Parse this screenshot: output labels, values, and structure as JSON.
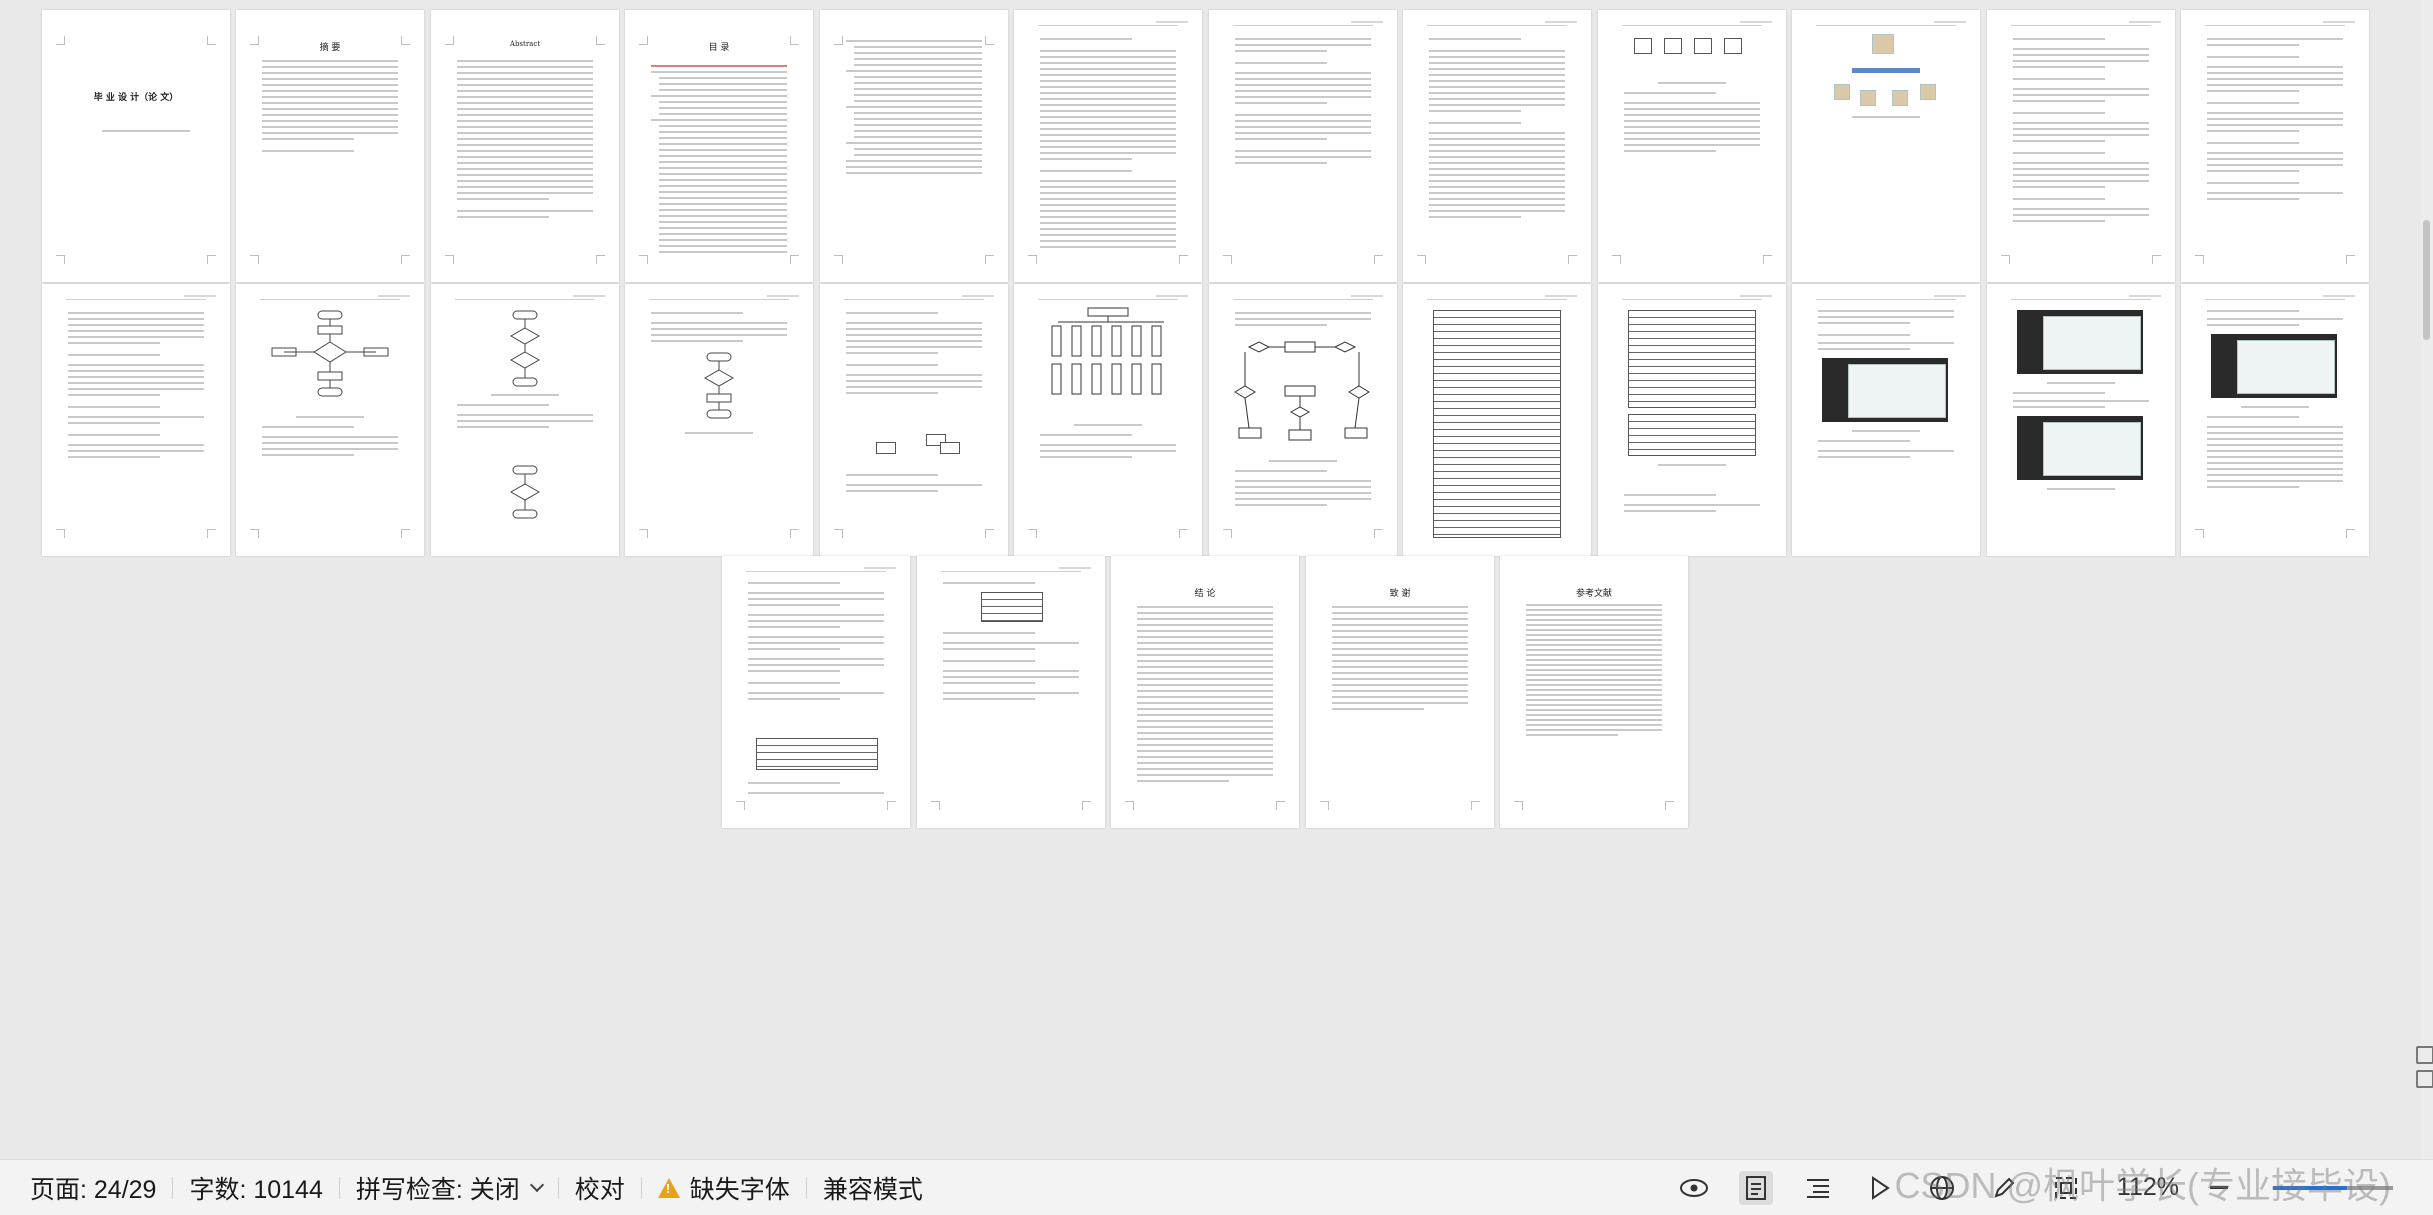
{
  "status_bar": {
    "page": "页面: 24/29",
    "word_count": "字数: 10144",
    "spell_check": "拼写检查: 关闭",
    "proofread": "校对",
    "missing_fonts": "缺失字体",
    "compat_mode": "兼容模式",
    "zoom": "112%"
  },
  "zoom_fraction": 0.62,
  "watermark": "CSDN @枫叶学长(专业接毕设)",
  "pages": {
    "cover_title": "毕 业 设 计（论 文）",
    "abstract_cn_title": "摘  要",
    "abstract_en_title": "Abstract",
    "toc_title": "目  录",
    "conclusion_title": "结  论",
    "thanks_title": "致  谢",
    "refs_title": "参考文献"
  },
  "colors": {
    "accent": "#2b6fd6",
    "warning": "#e8a21a"
  },
  "icons": {
    "warning": "warning-icon",
    "view": "eye-icon",
    "print_layout": "page-view-icon",
    "outline": "outline-list-icon",
    "play": "play-icon",
    "web": "globe-icon",
    "pen": "pen-icon",
    "zoom_fit": "fit-page-icon"
  }
}
